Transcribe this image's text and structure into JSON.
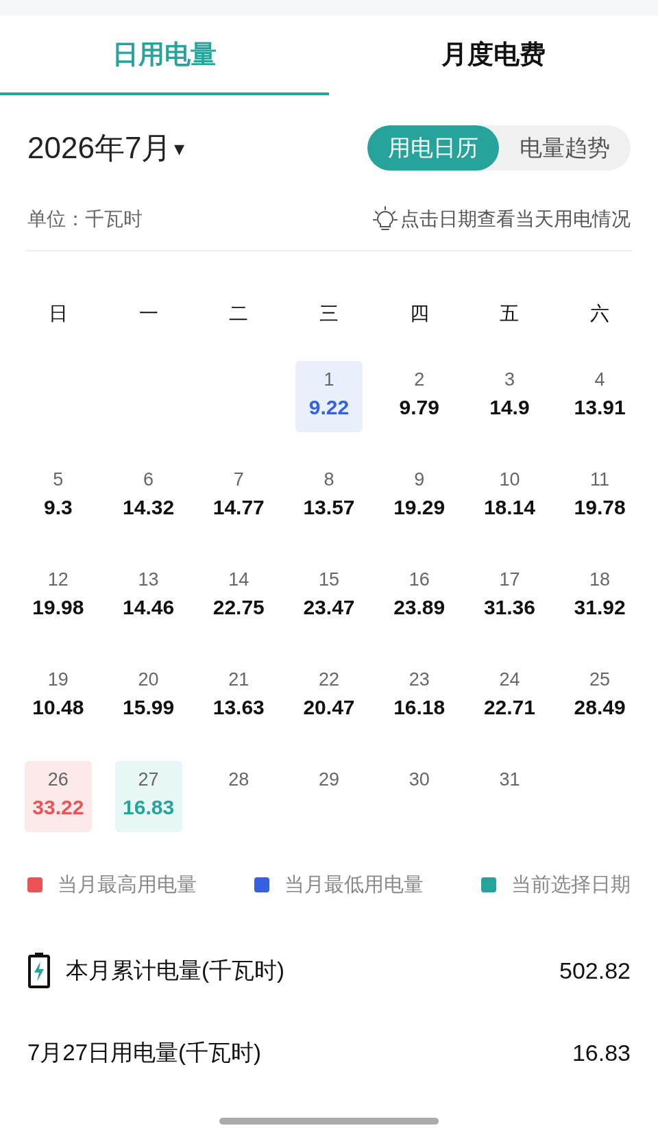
{
  "tabs": [
    {
      "label": "日用电量",
      "selected": true
    },
    {
      "label": "月度电费",
      "selected": false
    }
  ],
  "month": {
    "label": "2026年7月",
    "caret": "▾"
  },
  "view_toggle": [
    {
      "label": "用电日历",
      "selected": true
    },
    {
      "label": "电量趋势",
      "selected": false
    }
  ],
  "unit": "单位：千瓦时",
  "hint": "点击日期查看当天用电情况",
  "weekdays": [
    "日",
    "一",
    "二",
    "三",
    "四",
    "五",
    "六"
  ],
  "weeks": [
    [
      {
        "kind": "blank"
      },
      {
        "kind": "blank"
      },
      {
        "kind": "blank"
      },
      {
        "day": "1",
        "value": "9.22",
        "kind": "min"
      },
      {
        "day": "2",
        "value": "9.79",
        "kind": "normal"
      },
      {
        "day": "3",
        "value": "14.9",
        "kind": "normal"
      },
      {
        "day": "4",
        "value": "13.91",
        "kind": "normal"
      }
    ],
    [
      {
        "day": "5",
        "value": "9.3",
        "kind": "normal"
      },
      {
        "day": "6",
        "value": "14.32",
        "kind": "normal"
      },
      {
        "day": "7",
        "value": "14.77",
        "kind": "normal"
      },
      {
        "day": "8",
        "value": "13.57",
        "kind": "normal"
      },
      {
        "day": "9",
        "value": "19.29",
        "kind": "normal"
      },
      {
        "day": "10",
        "value": "18.14",
        "kind": "normal"
      },
      {
        "day": "11",
        "value": "19.78",
        "kind": "normal"
      }
    ],
    [
      {
        "day": "12",
        "value": "19.98",
        "kind": "normal"
      },
      {
        "day": "13",
        "value": "14.46",
        "kind": "normal"
      },
      {
        "day": "14",
        "value": "22.75",
        "kind": "normal"
      },
      {
        "day": "15",
        "value": "23.47",
        "kind": "normal"
      },
      {
        "day": "16",
        "value": "23.89",
        "kind": "normal"
      },
      {
        "day": "17",
        "value": "31.36",
        "kind": "normal"
      },
      {
        "day": "18",
        "value": "31.92",
        "kind": "normal"
      }
    ],
    [
      {
        "day": "19",
        "value": "10.48",
        "kind": "normal"
      },
      {
        "day": "20",
        "value": "15.99",
        "kind": "normal"
      },
      {
        "day": "21",
        "value": "13.63",
        "kind": "normal"
      },
      {
        "day": "22",
        "value": "20.47",
        "kind": "normal"
      },
      {
        "day": "23",
        "value": "16.18",
        "kind": "normal"
      },
      {
        "day": "24",
        "value": "22.71",
        "kind": "normal"
      },
      {
        "day": "25",
        "value": "28.49",
        "kind": "normal"
      }
    ],
    [
      {
        "day": "26",
        "value": "33.22",
        "kind": "max"
      },
      {
        "day": "27",
        "value": "16.83",
        "kind": "selected"
      },
      {
        "day": "28",
        "kind": "future"
      },
      {
        "day": "29",
        "kind": "future"
      },
      {
        "day": "30",
        "kind": "future"
      },
      {
        "day": "31",
        "kind": "future"
      },
      {
        "kind": "blank"
      }
    ]
  ],
  "legend": [
    {
      "label": "当月最高用电量",
      "color": "#ea5455"
    },
    {
      "label": "当月最低用电量",
      "color": "#3461e0"
    },
    {
      "label": "当前选择日期",
      "color": "#26a39b"
    }
  ],
  "summary": [
    {
      "label": "本月累计电量(千瓦时)",
      "value": "502.82",
      "kind": "battery"
    },
    {
      "label": "7月27日用电量(千瓦时)",
      "value": "16.83",
      "kind": "plain"
    }
  ]
}
